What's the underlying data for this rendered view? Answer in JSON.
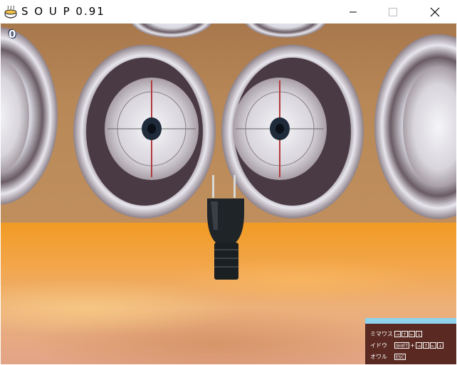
{
  "window": {
    "title": "S O U P 0.91",
    "icons": {
      "app": "soup-bowl-icon",
      "minimize": "minimize-icon",
      "maximize": "maximize-icon",
      "close": "close-icon"
    }
  },
  "game": {
    "counter": "0",
    "colors": {
      "wall": "#b98755",
      "floor": "#f09b24",
      "hud_bg": "#5a2a22",
      "hud_accent": "#8ed2ee"
    }
  },
  "controls": [
    {
      "label": "ミマワス",
      "keys": [
        "→",
        "↑",
        "←",
        "↓"
      ]
    },
    {
      "label": "イドウ",
      "keys": [
        "SHIFT",
        "+",
        "→",
        "↑",
        "←",
        "↓"
      ]
    },
    {
      "label": "オワル",
      "keys": [
        "ESC"
      ]
    }
  ]
}
